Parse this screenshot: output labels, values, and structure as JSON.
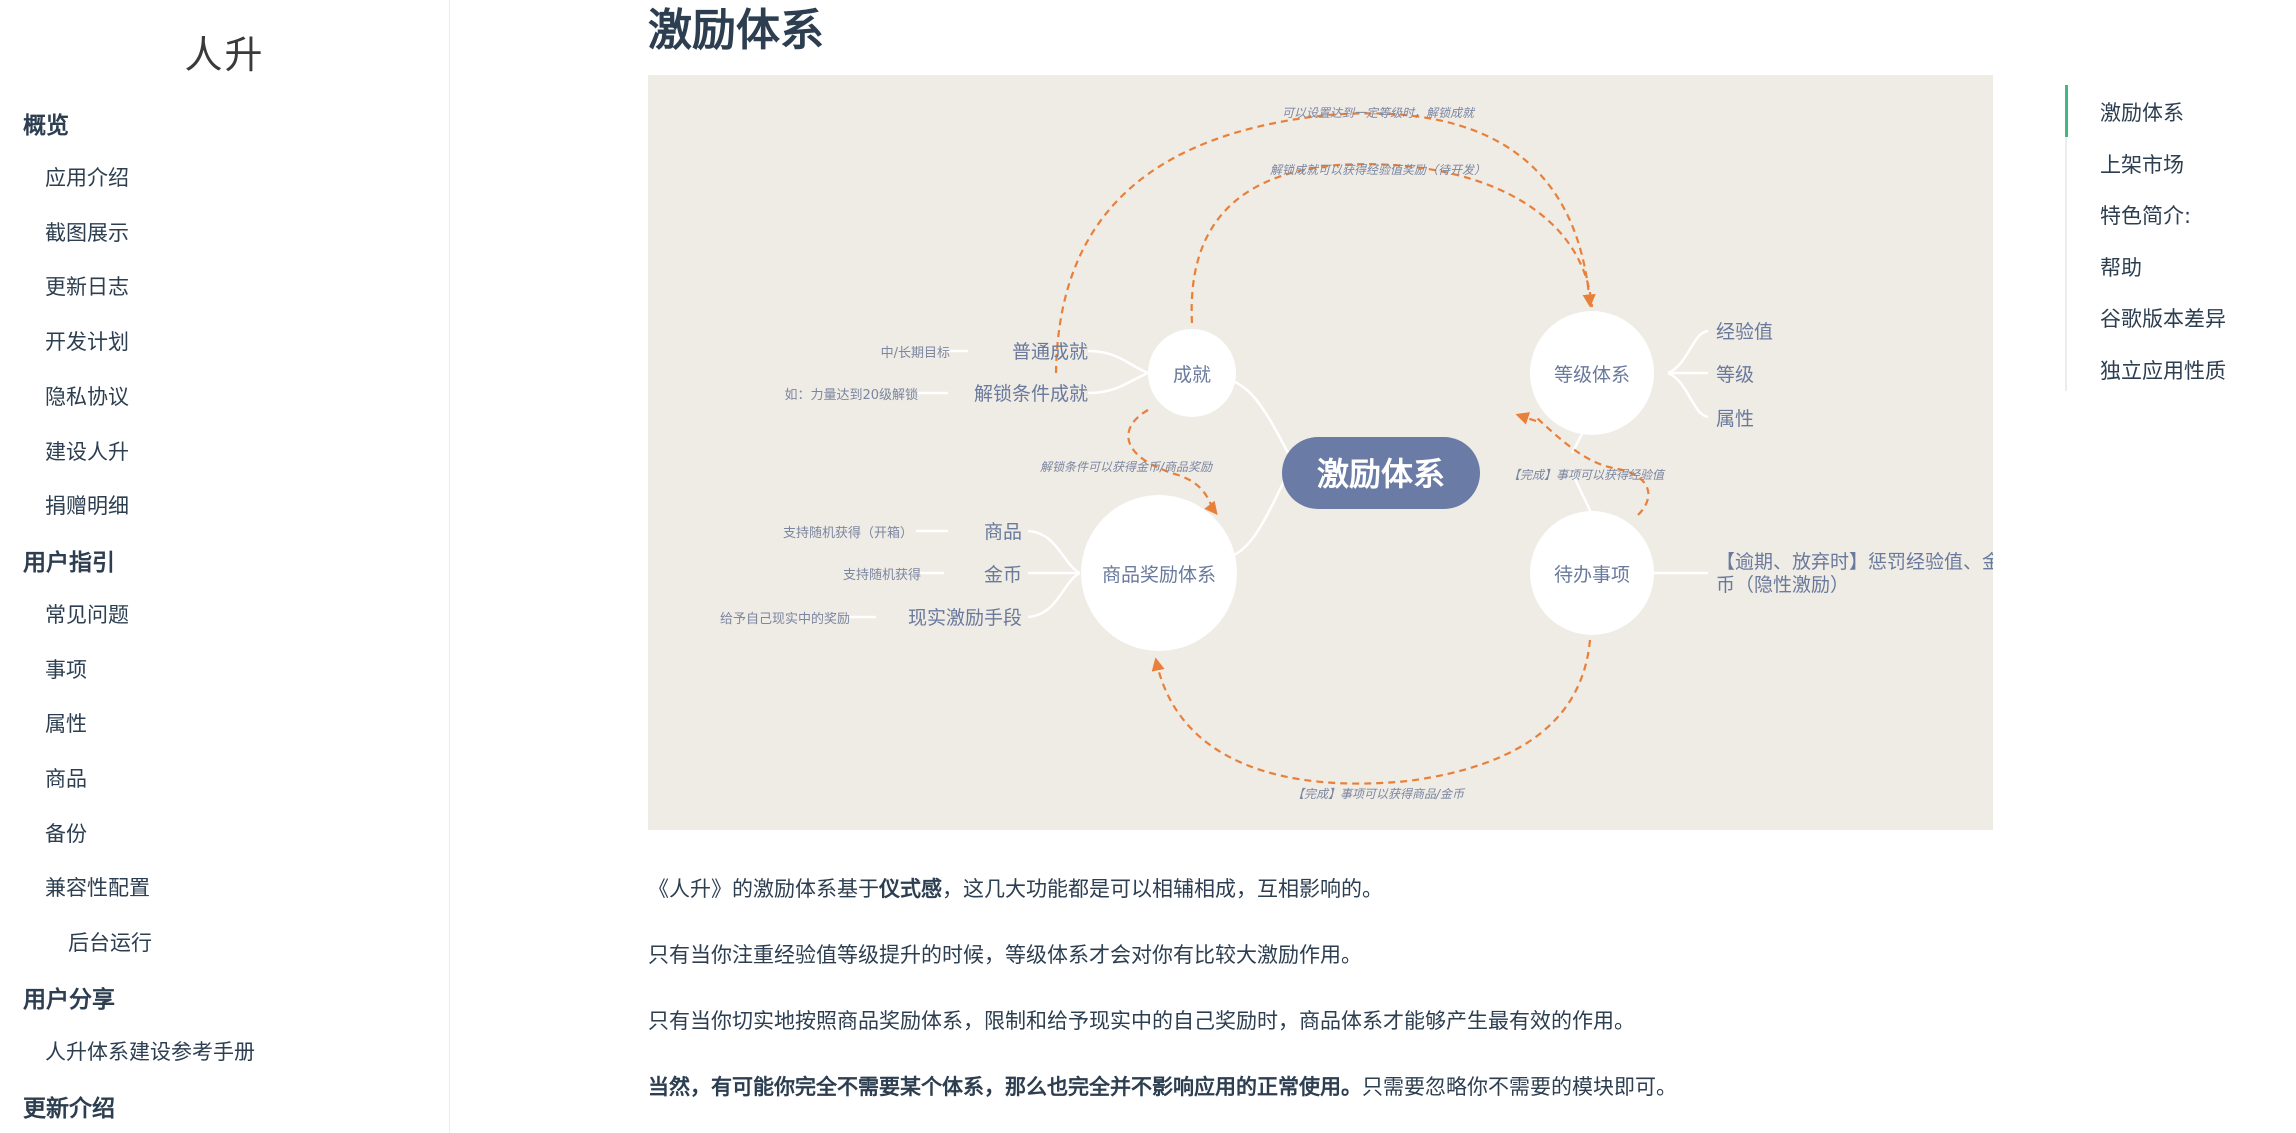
{
  "sidebar": {
    "site_title": "人升",
    "groups": [
      {
        "label": "概览",
        "items": [
          "应用介绍",
          "截图展示",
          "更新日志",
          "开发计划",
          "隐私协议",
          "建设人升",
          "捐赠明细"
        ]
      },
      {
        "label": "用户指引",
        "items": [
          "常见问题",
          "事项",
          "属性",
          "商品",
          "备份",
          "兼容性配置"
        ],
        "subitems": [
          "后台运行"
        ]
      },
      {
        "label": "用户分享",
        "items": [
          "人升体系建设参考手册"
        ]
      },
      {
        "label": "更新介绍",
        "items": []
      }
    ]
  },
  "main": {
    "heading": "激励体系",
    "paragraphs": {
      "p1_a": "《人升》的激励体系基于",
      "p1_b": "仪式感",
      "p1_c": "，这几大功能都是可以相辅相成，互相影响的。",
      "p2": "只有当你注重经验值等级提升的时候，等级体系才会对你有比较大激励作用。",
      "p3": "只有当你切实地按照商品奖励体系，限制和给予现实中的自己奖励时，商品体系才能够产生最有效的作用。",
      "p4_bold": "当然，有可能你完全不需要某个体系，那么也完全并不影响应用的正常使用。",
      "p4_rest": "只需要忽略你不需要的模块即可。"
    }
  },
  "mindmap": {
    "center": "激励体系",
    "achievement": "成就",
    "achievement_children": [
      {
        "label": "普通成就",
        "note": "中/长期目标"
      },
      {
        "label": "解锁条件成就",
        "note": "如：力量达到20级解锁"
      }
    ],
    "level_system": "等级体系",
    "level_children": [
      "经验值",
      "等级",
      "属性"
    ],
    "shop_system": "商品奖励体系",
    "shop_children": [
      {
        "label": "商品",
        "note": "支持随机获得（开箱）"
      },
      {
        "label": "金币",
        "note": "支持随机获得"
      },
      {
        "label": "现实激励手段",
        "note": "给予自己现实中的奖励"
      }
    ],
    "todo": "待办事项",
    "todo_children": [
      "【逾期、放弃时】惩罚经验值、金",
      "币（隐性激励）"
    ],
    "arrows": {
      "a_top": "可以设置达到一定等级时，解锁成就",
      "a_top2": "解锁成就可以获得经验值奖励（待开发）",
      "a_mid": "解锁条件可以获得金币/商品奖励",
      "a_right": "【完成】事项可以获得经验值",
      "a_bottom": "【完成】事项可以获得商品/金币"
    },
    "colors": {
      "bg": "#efebe5",
      "node": "#ffffff",
      "center": "#6a7ba6",
      "text": "#6a7a9c",
      "arrow": "#e8803a",
      "line": "#ffffff"
    }
  },
  "toc": {
    "items": [
      "激励体系",
      "上架市场",
      "特色简介:",
      "帮助",
      "谷歌版本差异",
      "独立应用性质"
    ],
    "active_index": 0
  },
  "colors": {
    "accent": "#42b983",
    "text": "#2c3e50"
  }
}
